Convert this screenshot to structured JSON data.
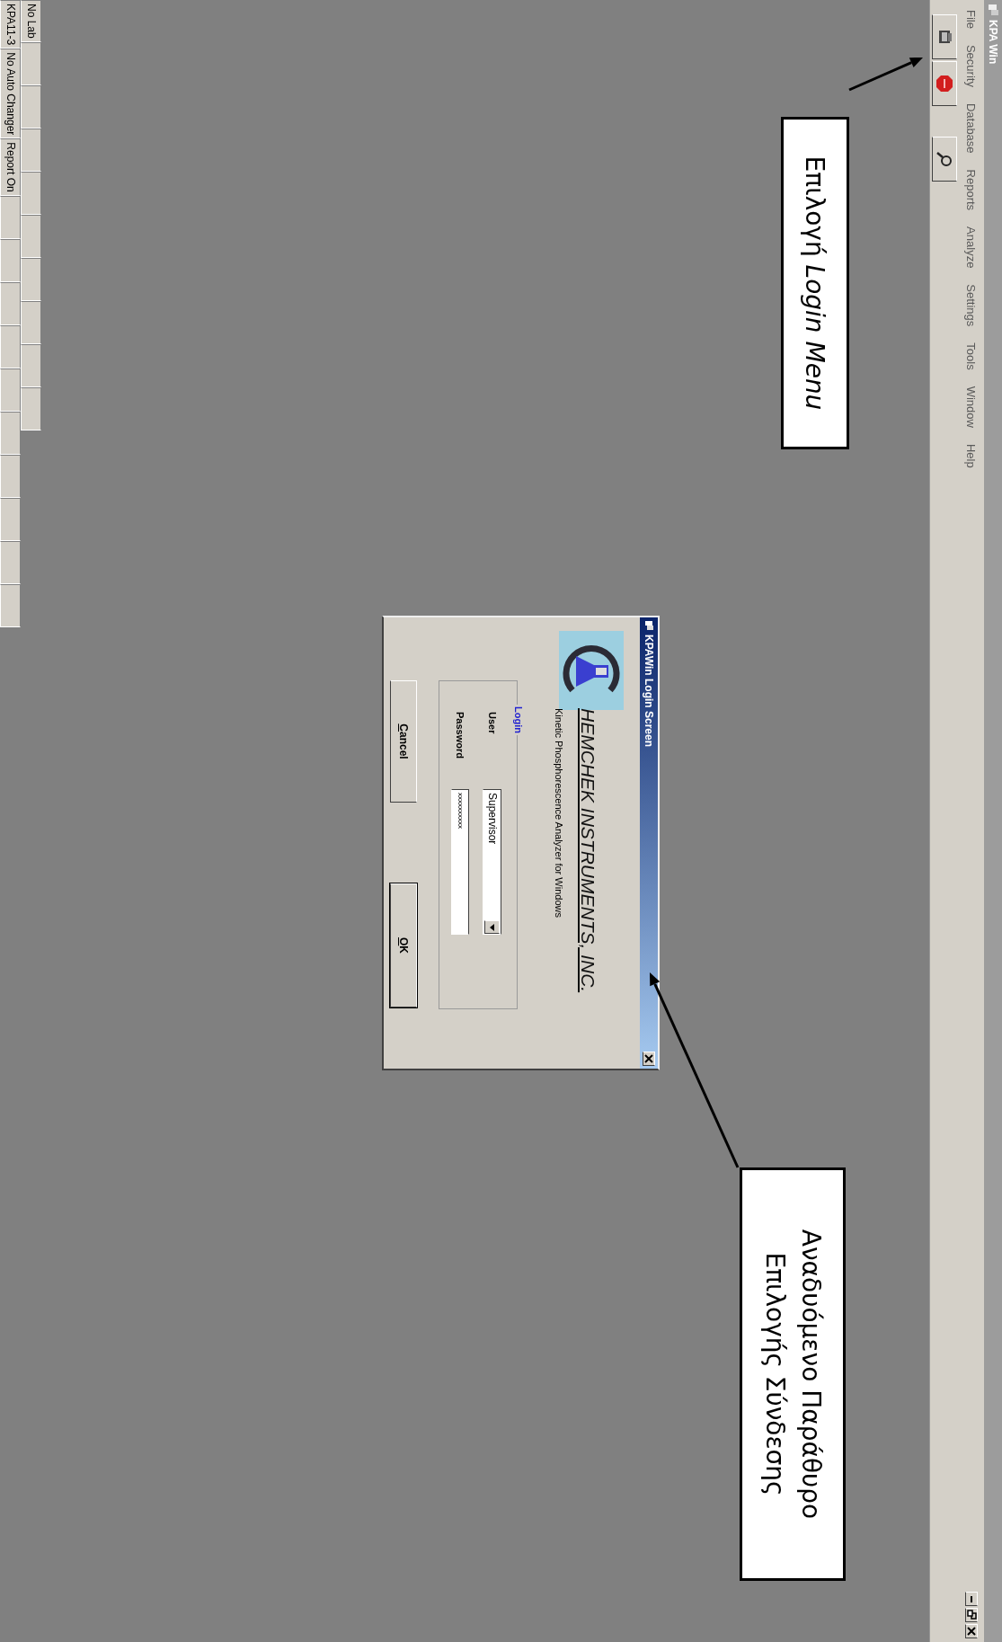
{
  "window": {
    "title": "KPA Win"
  },
  "menu": [
    "File",
    "Security",
    "Database",
    "Reports",
    "Analyze",
    "Settings",
    "Tools",
    "Window",
    "Help"
  ],
  "caption_buttons": [
    {
      "kind": "minimize"
    },
    {
      "kind": "restore"
    },
    {
      "kind": "close"
    }
  ],
  "toolbar": [
    {
      "kind": "device"
    },
    {
      "kind": "stop"
    },
    {
      "kind": "login"
    }
  ],
  "login_dialog": {
    "title": "KPAWin Login Screen",
    "company": "HEMCHEK INSTRUMENTS, INC.",
    "subtitle": "Kinetic Phosphorescence Analyzer for Windows",
    "group_label": "Login",
    "user_label": "User",
    "user_value": "Supervisor",
    "password_label": "Password",
    "password_value": "xxxxxxxxxx",
    "buttons": [
      {
        "mnemonic": "C",
        "label_rest": "ancel",
        "default": false
      },
      {
        "mnemonic": "O",
        "label_rest": "K",
        "default": true
      }
    ]
  },
  "annotations": [
    {
      "lines": [
        "Επιλογή *Login Menu*"
      ]
    },
    {
      "lines": [
        "Αναδυόμενο Παράθυρο",
        "Επιλογής Σύνδεσης"
      ]
    }
  ],
  "status_bar": {
    "upper_panels": [
      "No Lab"
    ],
    "lower_panels": [
      "KPA11-3",
      "No Auto Changer",
      "Report On"
    ]
  }
}
